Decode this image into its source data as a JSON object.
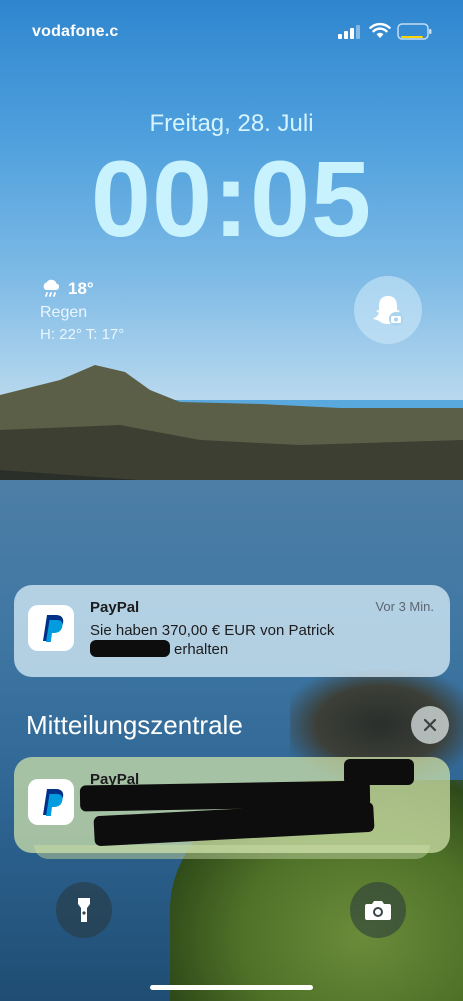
{
  "status_bar": {
    "carrier": "vodafone.c"
  },
  "lock_screen": {
    "date": "Freitag, 28. Juli",
    "time": "00:05"
  },
  "weather": {
    "temperature": "18°",
    "condition": "Regen",
    "high_low": "H: 22° T: 17°",
    "icon": "rain-cloud-icon"
  },
  "notification_1": {
    "app": "PayPal",
    "time": "Vor 3 Min.",
    "line1": "Sie haben 370,00 € EUR von Patrick",
    "line2": "erhalten"
  },
  "notification_center": {
    "title": "Mitteilungszentrale"
  },
  "notification_2": {
    "app": "PayPal"
  },
  "colors": {
    "time_color": "#c9f2ff",
    "paypal_dark": "#003087",
    "paypal_light": "#009cde"
  }
}
